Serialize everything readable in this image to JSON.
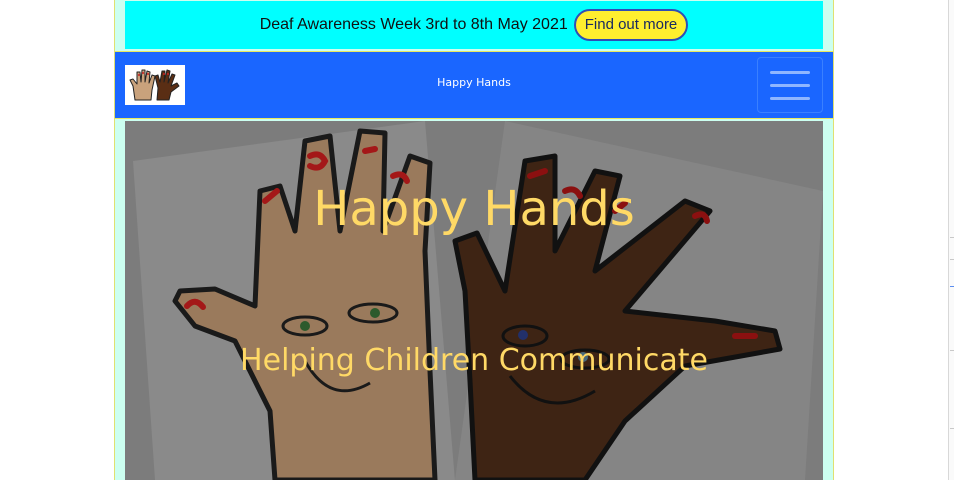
{
  "announcement": {
    "text": "Deaf Awareness Week 3rd to 8th May 2021",
    "button_label": "Find out more"
  },
  "navbar": {
    "brand": "Happy Hands",
    "logo_icon": "hands-logo-icon",
    "toggler_icon": "hamburger-menu-icon"
  },
  "hero": {
    "title": "Happy Hands",
    "subtitle": "Helping Children Communicate",
    "image_icon": "cartoon-hands-image"
  },
  "colors": {
    "announcement_bg": "#00ffff",
    "button_bg": "#ffef2e",
    "navbar_bg": "#1a66ff",
    "hero_text": "#ffd966",
    "frame_bg": "#ccfff0"
  }
}
